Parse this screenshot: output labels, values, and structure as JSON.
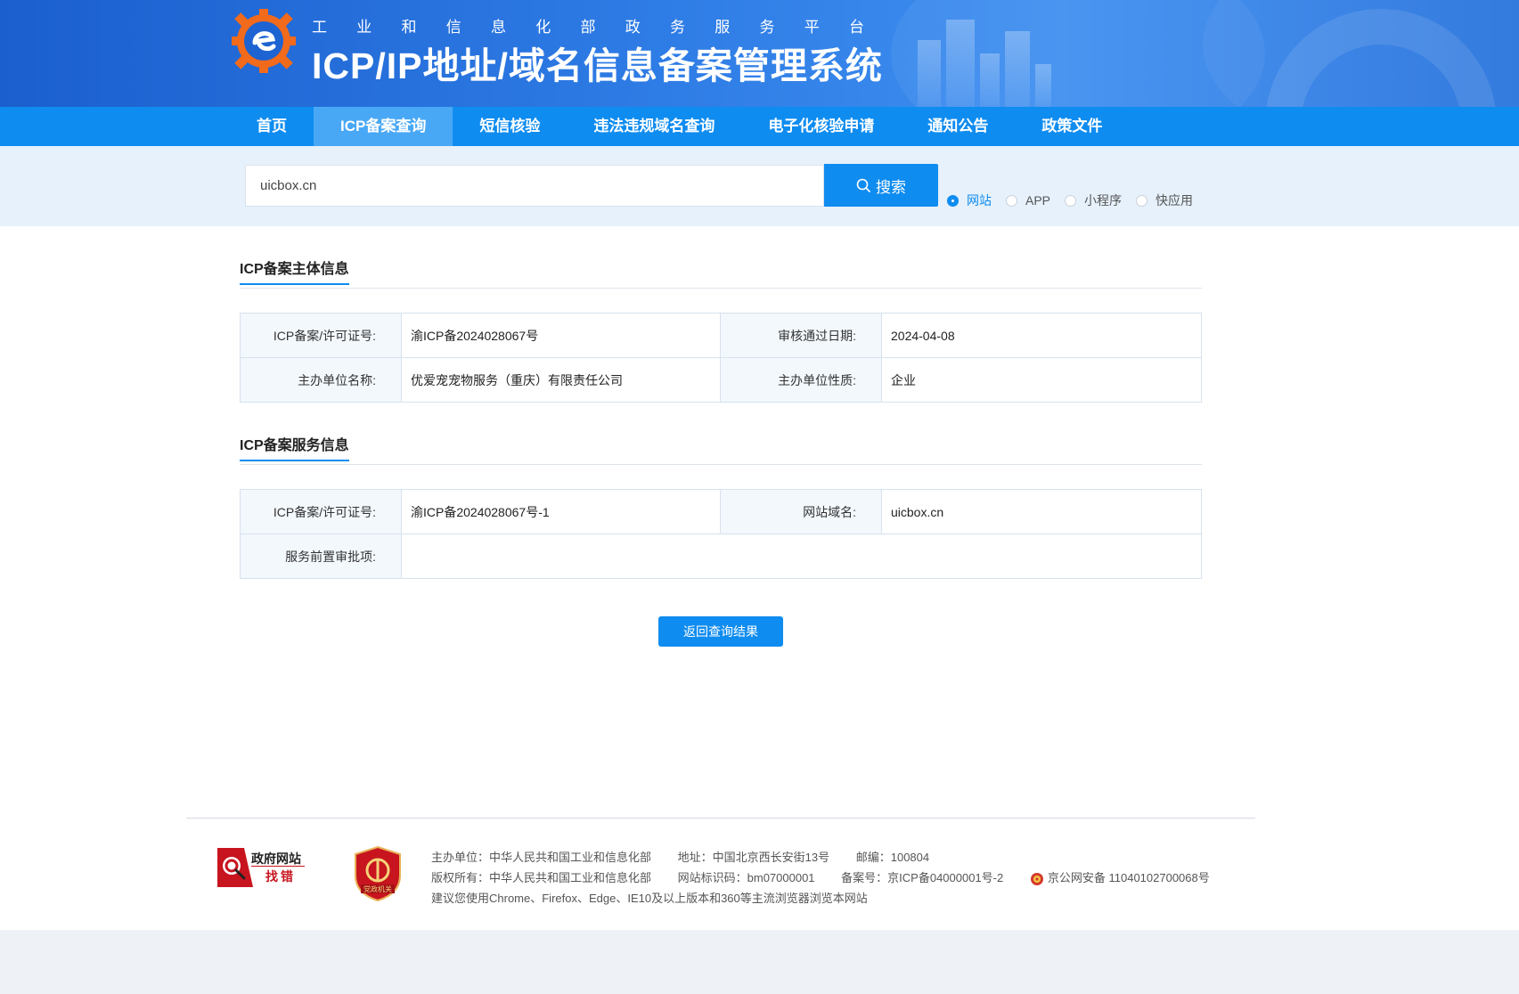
{
  "header": {
    "subtitle_chars": [
      "工",
      "业",
      "和",
      "信",
      "息",
      "化",
      "部",
      "政",
      "务",
      "服",
      "务",
      "平",
      "台"
    ],
    "title": "ICP/IP地址/域名信息备案管理系统"
  },
  "nav": {
    "items": [
      {
        "label": "首页"
      },
      {
        "label": "ICP备案查询"
      },
      {
        "label": "短信核验"
      },
      {
        "label": "违法违规域名查询"
      },
      {
        "label": "电子化核验申请"
      },
      {
        "label": "通知公告"
      },
      {
        "label": "政策文件"
      }
    ],
    "active_index": 1
  },
  "search": {
    "value": "uicbox.cn",
    "button_label": "搜索",
    "types": [
      {
        "label": "网站",
        "checked": true
      },
      {
        "label": "APP",
        "checked": false
      },
      {
        "label": "小程序",
        "checked": false
      },
      {
        "label": "快应用",
        "checked": false
      }
    ]
  },
  "subject": {
    "title": "ICP备案主体信息",
    "rows": [
      {
        "k1": "ICP备案/许可证号:",
        "v1": "渝ICP备2024028067号",
        "k2": "审核通过日期:",
        "v2": "2024-04-08"
      },
      {
        "k1": "主办单位名称:",
        "v1": "优爱宠宠物服务（重庆）有限责任公司",
        "k2": "主办单位性质:",
        "v2": "企业"
      }
    ]
  },
  "service": {
    "title": "ICP备案服务信息",
    "row1": {
      "k1": "ICP备案/许可证号:",
      "v1": "渝ICP备2024028067号-1",
      "k2": "网站域名:",
      "v2": "uicbox.cn"
    },
    "row2": {
      "k1": "服务前置审批项:",
      "v1": ""
    }
  },
  "back_button": "返回查询结果",
  "footer": {
    "gov_badge": {
      "line1": "政府网站",
      "line2": "找错"
    },
    "party_badge": "党政机关",
    "line1": [
      "主办单位：中华人民共和国工业和信息化部",
      "地址：中国北京西长安街13号",
      "邮编：100804"
    ],
    "line2": [
      "版权所有：中华人民共和国工业和信息化部",
      "网站标识码：bm07000001",
      "备案号：京ICP备04000001号-2"
    ],
    "police": "京公网安备 11040102700068号",
    "line3": "建议您使用Chrome、Firefox、Edge、IE10及以上版本和360等主流浏览器浏览本网站"
  },
  "colors": {
    "primary": "#0f8cf0",
    "banner": "#2f7de6",
    "active_nav": "#49a8f5",
    "label_bg": "#f3f8fd"
  }
}
